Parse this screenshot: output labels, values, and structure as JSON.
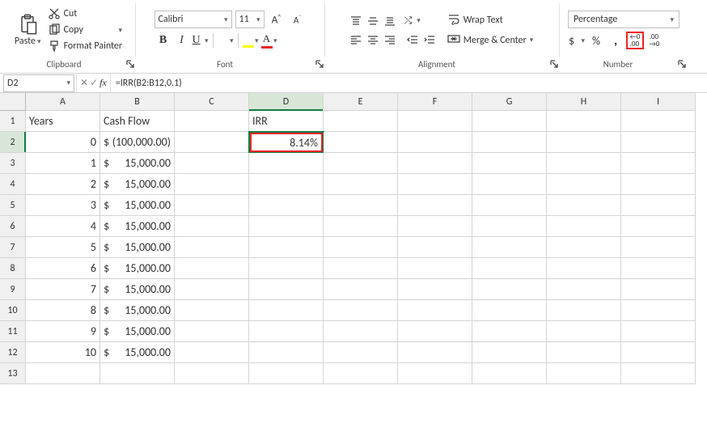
{
  "ribbon": {
    "clipboard": {
      "paste": "Paste",
      "cut": "Cut",
      "copy": "Copy",
      "format_painter": "Format Painter",
      "label": "Clipboard"
    },
    "font": {
      "name": "Calibri",
      "size": "11",
      "label": "Font"
    },
    "alignment": {
      "wrap": "Wrap Text",
      "merge": "Merge & Center",
      "label": "Alignment"
    },
    "number": {
      "format": "Percentage",
      "label": "Number"
    }
  },
  "formula_bar": {
    "cell_ref": "D2",
    "formula": "=IRR(B2:B12,0.1)"
  },
  "columns": [
    "A",
    "B",
    "C",
    "D",
    "E",
    "F",
    "G",
    "H",
    "I"
  ],
  "rows": [
    "1",
    "2",
    "3",
    "4",
    "5",
    "6",
    "7",
    "8",
    "9",
    "10",
    "11",
    "12",
    "13"
  ],
  "headers": {
    "A1": "Years",
    "B1": "Cash Flow",
    "D1": "IRR"
  },
  "years": [
    "0",
    "1",
    "2",
    "3",
    "4",
    "5",
    "6",
    "7",
    "8",
    "9",
    "10"
  ],
  "cashflow": [
    {
      "sym": "$",
      "amt": "(100,000.00)"
    },
    {
      "sym": "$",
      "amt": "15,000.00"
    },
    {
      "sym": "$",
      "amt": "15,000.00"
    },
    {
      "sym": "$",
      "amt": "15,000.00"
    },
    {
      "sym": "$",
      "amt": "15,000.00"
    },
    {
      "sym": "$",
      "amt": "15,000.00"
    },
    {
      "sym": "$",
      "amt": "15,000.00"
    },
    {
      "sym": "$",
      "amt": "15,000.00"
    },
    {
      "sym": "$",
      "amt": "15,000.00"
    },
    {
      "sym": "$",
      "amt": "15,000.00"
    },
    {
      "sym": "$",
      "amt": "15,000.00"
    }
  ],
  "irr_value": "8.14%",
  "chart_data": {
    "type": "table",
    "title": "IRR calculation",
    "columns": [
      "Years",
      "Cash Flow"
    ],
    "years": [
      0,
      1,
      2,
      3,
      4,
      5,
      6,
      7,
      8,
      9,
      10
    ],
    "cash_flow": [
      -100000,
      15000,
      15000,
      15000,
      15000,
      15000,
      15000,
      15000,
      15000,
      15000,
      15000
    ],
    "irr_guess": 0.1,
    "irr_result_percent": 8.14
  }
}
